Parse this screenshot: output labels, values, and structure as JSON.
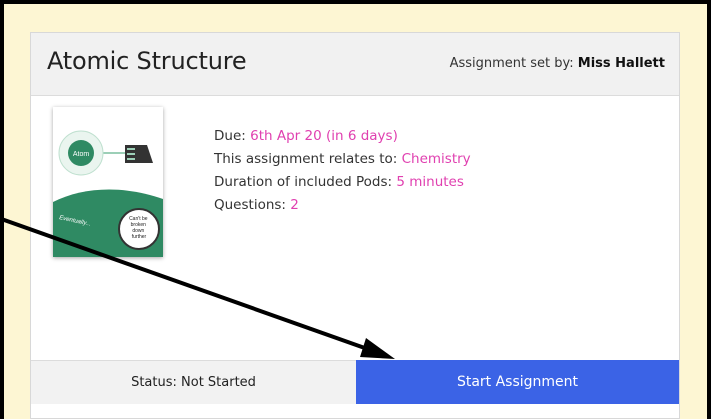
{
  "card": {
    "title": "Atomic Structure",
    "set_by_label": "Assignment set by: ",
    "set_by_name": "Miss Hallett"
  },
  "thumbnail": {
    "atom_label": "Atom",
    "eventually_label": "Eventually...",
    "bubble_text": "Can't be broken down further"
  },
  "details": {
    "due_label": "Due: ",
    "due_value": "6th Apr 20 (in 6 days)",
    "relates_label": "This assignment relates to: ",
    "relates_value": "Chemistry",
    "duration_label": "Duration of included Pods: ",
    "duration_value": "5 minutes",
    "questions_label": "Questions: ",
    "questions_value": "2"
  },
  "footer": {
    "status_label": "Status: ",
    "status_value": "Not Started",
    "start_button": "Start Assignment"
  },
  "colors": {
    "accent_link": "#e040b0",
    "button_blue": "#3b63e6",
    "background": "#fdf6d3",
    "thumb_green": "#2f8a63"
  }
}
